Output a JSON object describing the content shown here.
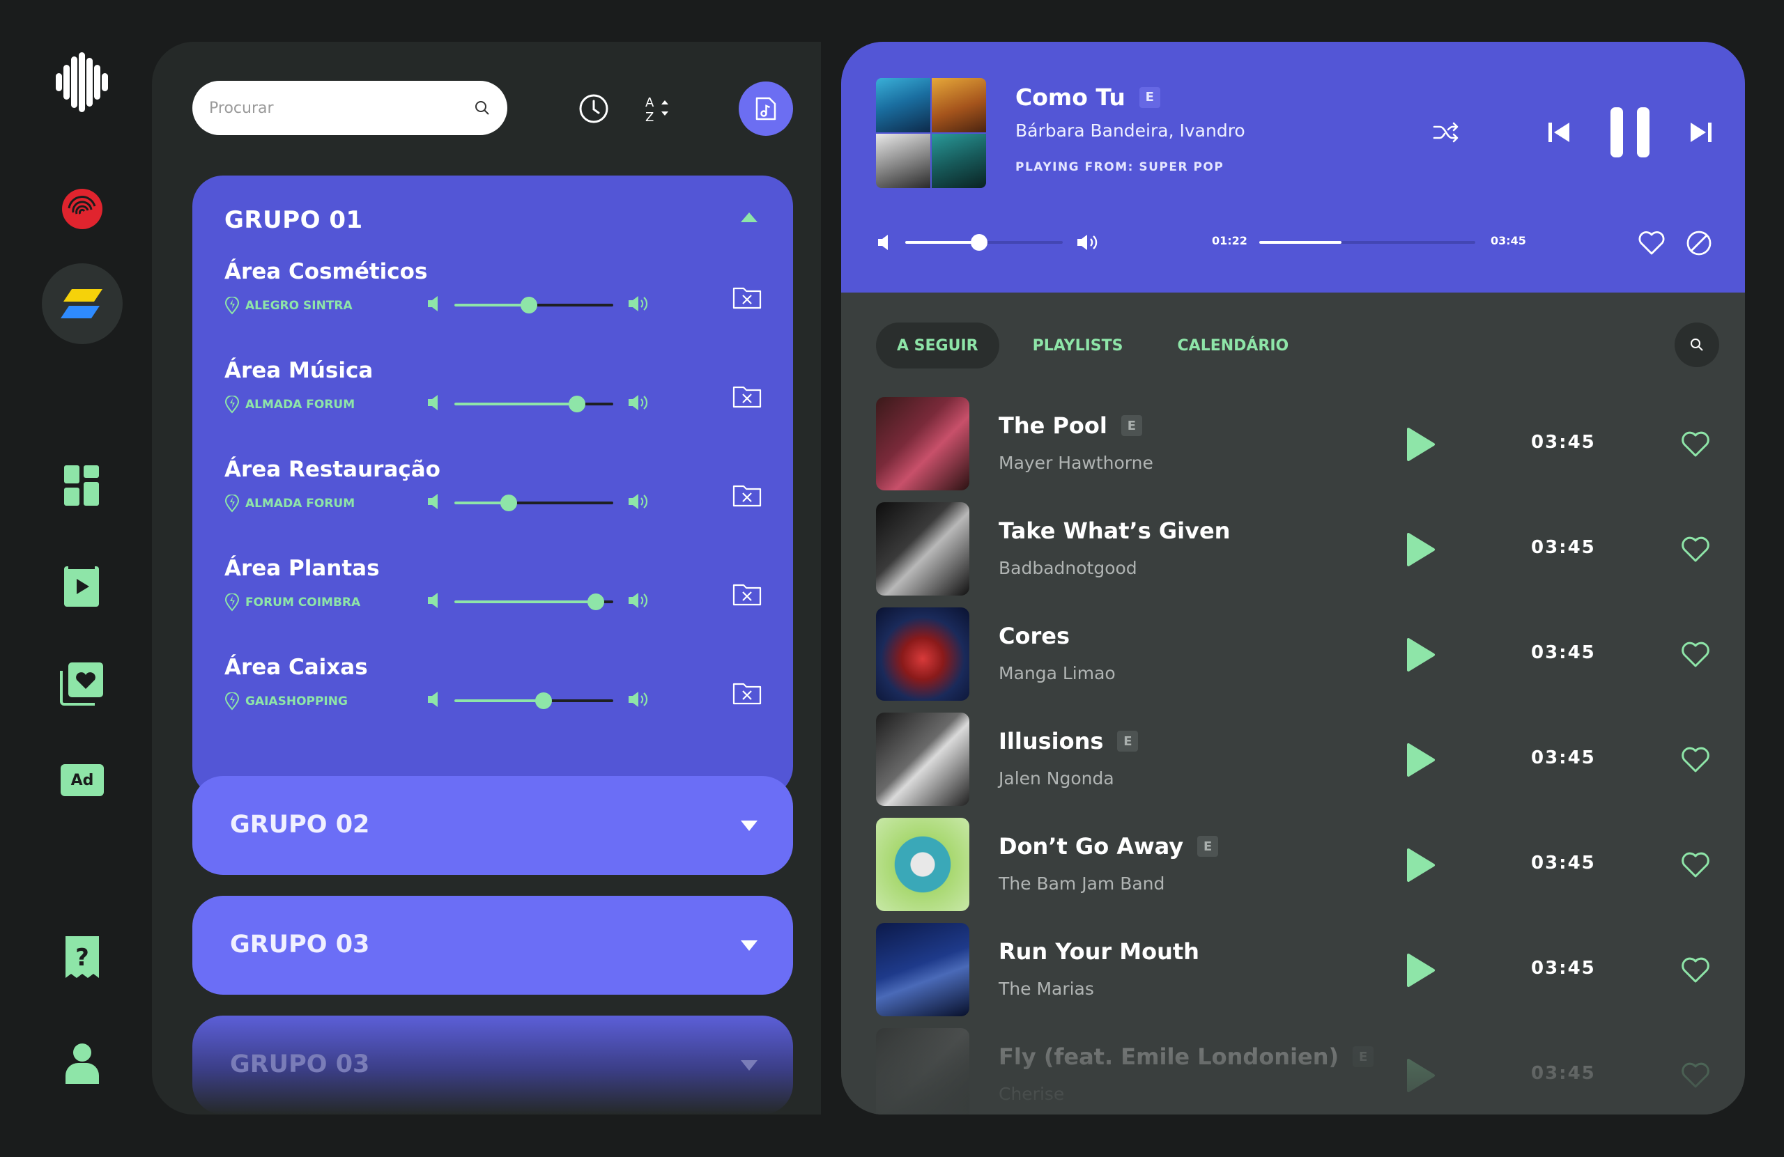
{
  "colors": {
    "background": "#1a1c1c",
    "panel": "#252928",
    "queue_panel": "#3a3f3e",
    "group_open": "#5356d6",
    "group_closed": "#6b6ef6",
    "accent_green": "#8ee5a8"
  },
  "sidebar": {
    "items": [
      {
        "icon": "soundwave-logo-icon",
        "active": false
      },
      {
        "icon": "fingerprint-icon",
        "active": false
      },
      {
        "icon": "brand-app-icon",
        "active": true
      },
      {
        "icon": "dashboard-grid-icon",
        "active": false
      },
      {
        "icon": "play-square-icon",
        "active": false
      },
      {
        "icon": "favorites-stack-icon",
        "active": false
      },
      {
        "icon": "ad-icon",
        "label": "Ad",
        "active": false
      },
      {
        "icon": "help-icon",
        "active": false
      },
      {
        "icon": "user-icon",
        "active": false
      }
    ]
  },
  "search": {
    "placeholder": "Procurar"
  },
  "groups": [
    {
      "title": "GRUPO 01",
      "expanded": true,
      "zones": [
        {
          "name": "Área Cosméticos",
          "location": "ALEGRO SINTRA",
          "volume": 0.47
        },
        {
          "name": "Área Música",
          "location": "ALMADA FORUM",
          "volume": 0.77
        },
        {
          "name": "Área Restauração",
          "location": "ALMADA FORUM",
          "volume": 0.34
        },
        {
          "name": "Área Plantas",
          "location": "FORUM COIMBRA",
          "volume": 0.89
        },
        {
          "name": "Área Caixas",
          "location": "GAIASHOPPING",
          "volume": 0.56
        }
      ]
    },
    {
      "title": "GRUPO 02",
      "expanded": false
    },
    {
      "title": "GRUPO 03",
      "expanded": false
    },
    {
      "title": "GRUPO 03",
      "expanded": false
    }
  ],
  "now_playing": {
    "title": "Como Tu",
    "explicit_badge": "E",
    "artist": "Bárbara Bandeira, Ivandro",
    "source": "PLAYING FROM: SUPER POP",
    "volume": 0.47,
    "elapsed": "01:22",
    "duration": "03:45",
    "progress": 0.38
  },
  "tabs": [
    {
      "label": "A SEGUIR",
      "active": true
    },
    {
      "label": "PLAYLISTS",
      "active": false
    },
    {
      "label": "CALENDÁRIO",
      "active": false
    }
  ],
  "queue": [
    {
      "title": "The Pool",
      "artist": "Mayer Hawthorne",
      "explicit": "E",
      "duration": "03:45"
    },
    {
      "title": "Take What’s Given",
      "artist": "Badbadnotgood",
      "explicit": "",
      "duration": "03:45"
    },
    {
      "title": "Cores",
      "artist": "Manga Limao",
      "explicit": "",
      "duration": "03:45"
    },
    {
      "title": "Illusions",
      "artist": "Jalen Ngonda",
      "explicit": "E",
      "duration": "03:45"
    },
    {
      "title": "Don’t Go Away",
      "artist": "The Bam Jam Band",
      "explicit": "E",
      "duration": "03:45"
    },
    {
      "title": "Run Your Mouth",
      "artist": "The Marias",
      "explicit": "",
      "duration": "03:45"
    },
    {
      "title": "Fly (feat. Emile Londonien)",
      "artist": "Cherise",
      "explicit": "E",
      "duration": "03:45"
    }
  ]
}
